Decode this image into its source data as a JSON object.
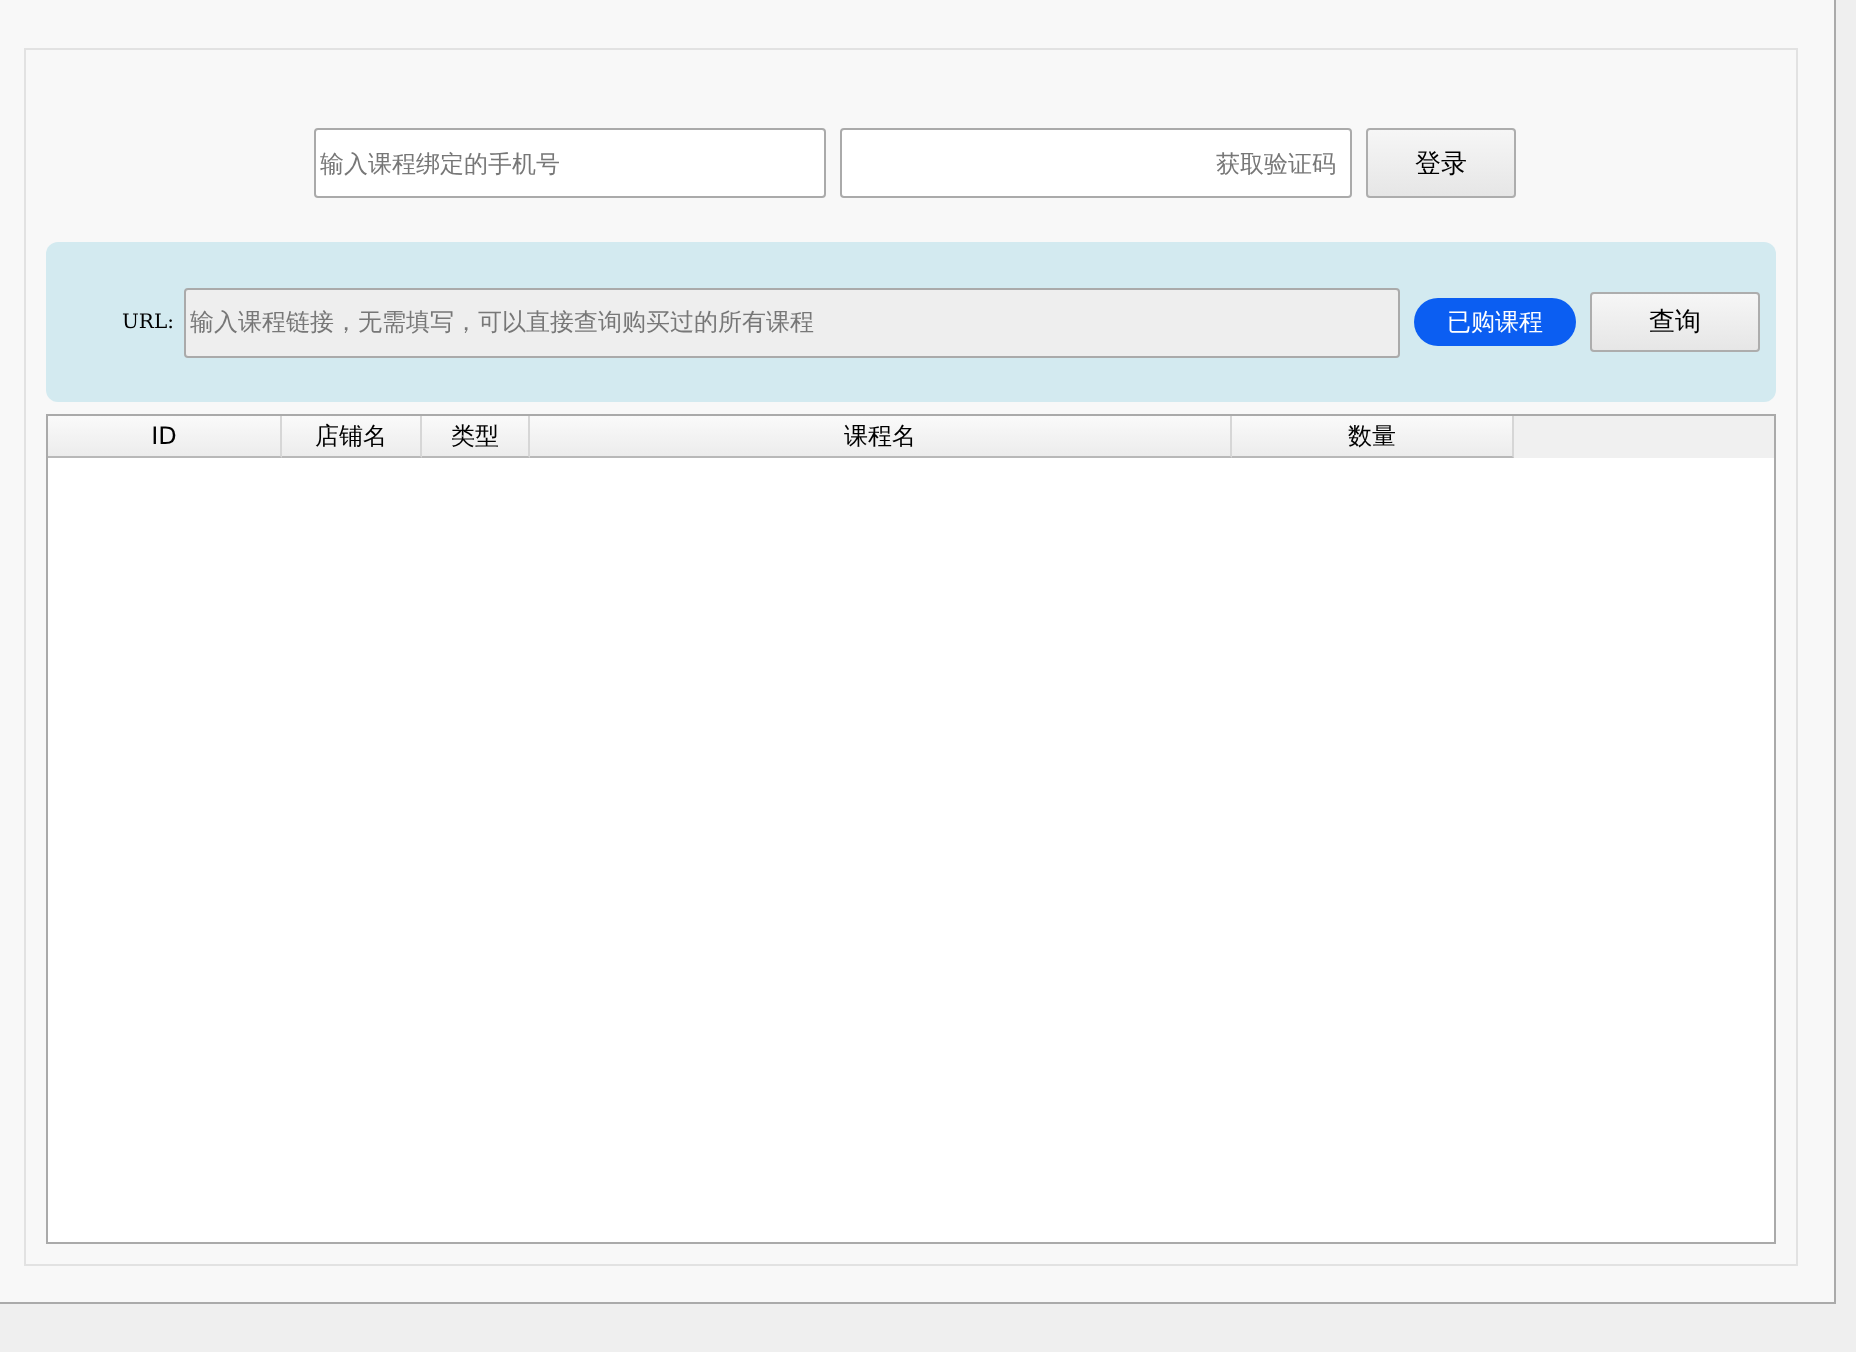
{
  "login": {
    "phone_field": {
      "placeholder": "输入课程绑定的手机号"
    },
    "code_field": {
      "placeholder": "获取验证码"
    },
    "login_button": "登录"
  },
  "query": {
    "url_label": "URL:",
    "url_field": {
      "placeholder": "输入课程链接，无需填写，可以直接查询购买过的所有课程"
    },
    "purchased_button": "已购课程",
    "query_button": "查询"
  },
  "table": {
    "columns": [
      "ID",
      "店铺名",
      "类型",
      "课程名",
      "数量"
    ]
  }
}
